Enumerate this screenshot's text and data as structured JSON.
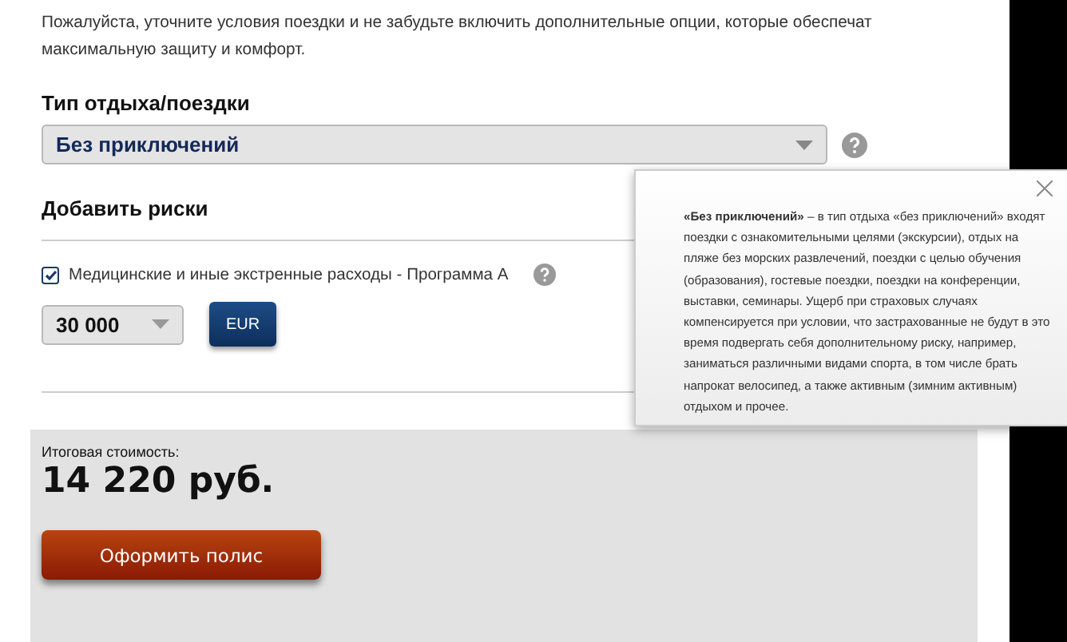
{
  "intro": "Пожалуйста, уточните условия поездки и не забудьте включить дополнительные опции, которые обеспечат максимальную защиту и комфорт.",
  "trip_type": {
    "label": "Тип отдыха/поездки",
    "value": "Без приключений"
  },
  "risks": {
    "title": "Добавить риски",
    "items": [
      {
        "label": "Медицинские и иные экстренные расходы - Программа А",
        "checked": true,
        "amount": "30 000",
        "currency": "EUR"
      }
    ]
  },
  "tooltip": {
    "text": "**«Без приключений»** – в тип отдыха «без приключений» входят поездки с ознакомительными целями (экскурсии), отдых на пляже без морских развлечений, поездки с целью обучения (образования), гостевые поездки, поездки на конференции, выставки, семинары. Ущерб при страховых случаях компенсируется при условии, что застрахованные не будут в это время подвергать себя дополнительному риску, например, заниматься различными видами спорта, в том числе брать напрокат велосипед, а также активным (зимним активным) отдыхом и прочее."
  },
  "total": {
    "label": "Итоговая стоимость:",
    "value": "14 220 руб.",
    "button": "Оформить полис"
  }
}
